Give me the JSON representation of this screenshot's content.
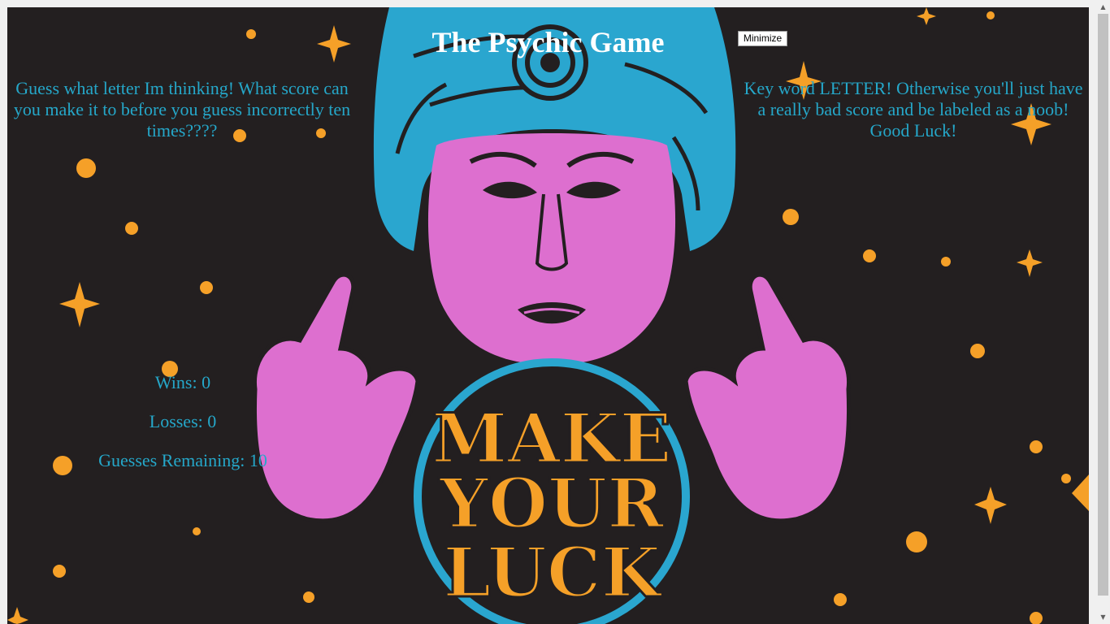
{
  "page": {
    "title": "The Psychic Game",
    "minimize_label": "Minimize",
    "intro_text": "Guess what letter Im thinking! What score can you make it to before you guess incorrectly ten times????",
    "tip_text": "Key word LETTER! Otherwise you'll just have a really bad score and be labeled as a noob! Good Luck!"
  },
  "stats": {
    "wins_label": "Wins: 0",
    "wins": 0,
    "losses_label": "Losses: 0",
    "losses": 0,
    "guesses_label": "Guesses Remaining: 10",
    "guesses_remaining": 10
  },
  "artwork": {
    "crystal_ball_text": [
      "MAKE",
      "YOUR",
      "LUCK"
    ],
    "colors": {
      "background": "#231f20",
      "skin": "#dd6fcf",
      "turban": "#2aa6cf",
      "star": "#f5a028",
      "ball_ring": "#2aa6cf",
      "text_accent": "#25a7c9"
    }
  }
}
